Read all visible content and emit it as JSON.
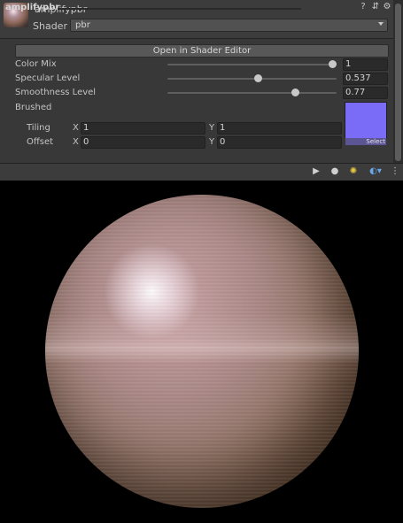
{
  "header": {
    "asset_name": "amplifypbr",
    "shader_label": "Shader",
    "shader_value": "pbr",
    "icons": [
      "help-icon",
      "sliders-icon",
      "gear-icon"
    ]
  },
  "properties": {
    "open_button": "Open in Shader Editor",
    "color_mix": {
      "label": "Color Mix",
      "value": "1",
      "fraction": 1.0
    },
    "specular_level": {
      "label": "Specular Level",
      "value": "0.537",
      "fraction": 0.537
    },
    "smoothness_level": {
      "label": "Smoothness Level",
      "value": "0.77",
      "fraction": 0.77
    },
    "brushed": {
      "label": "Brushed",
      "swatch_color": "#7a6cf7",
      "select_label": "Select"
    },
    "tiling": {
      "label": "Tiling",
      "x_label": "X",
      "x_value": "1",
      "y_label": "Y",
      "y_value": "1"
    },
    "offset": {
      "label": "Offset",
      "x_label": "X",
      "x_value": "0",
      "y_label": "Y",
      "y_value": "0"
    }
  },
  "preview": {
    "title": "amplifypbr",
    "icons": [
      "play-icon",
      "sphere-mesh-icon",
      "light-icon",
      "background-sphere-icon",
      "menu-icon"
    ]
  },
  "colors": {
    "panel_bg": "#383838",
    "field_bg": "#2a2a2a",
    "swatch": "#7a6cf7"
  }
}
